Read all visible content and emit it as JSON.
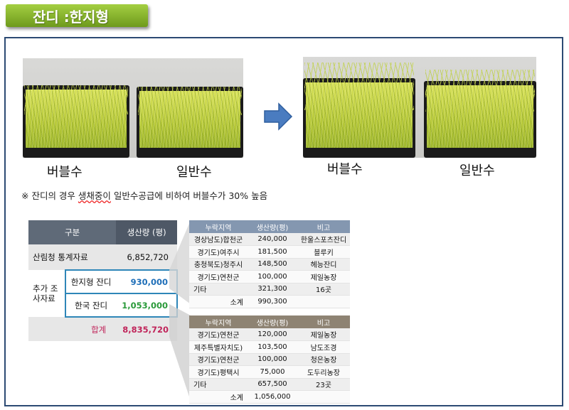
{
  "title": "잔디 :한지형",
  "photos": {
    "left_caption_1": "버블수",
    "left_caption_2": "일반수",
    "right_caption_1": "버블수",
    "right_caption_2": "일반수"
  },
  "note": {
    "prefix": "※ 잔디의 경우 ",
    "misspelled": "생채중이",
    "suffix": " 일반수공급에 비하여 버블수가 30% 높음"
  },
  "main_table": {
    "header_category": "구분",
    "header_production": "생산량 (평)",
    "row_forest_label": "산림청 통계자료",
    "row_forest_value": "6,852,720",
    "group_label": "추가 조사자료",
    "row_cool_label": "한지형 잔디",
    "row_cool_value": "930,000",
    "row_korean_label": "한국 잔디",
    "row_korean_value": "1,053,000",
    "total_label": "합계",
    "total_value": "8,835,720"
  },
  "top_table": {
    "headers": [
      "누락지역",
      "생산량(평)",
      "비고"
    ],
    "rows": [
      [
        "경상남도)합천군",
        "240,000",
        "한울스포츠잔디"
      ],
      [
        "경기도)여주시",
        "181,500",
        "블루키"
      ],
      [
        "충청북도)청주시",
        "148,500",
        "헤능잔디"
      ],
      [
        "경기도)연천군",
        "100,000",
        "제일농장"
      ],
      [
        "기타",
        "321,300",
        "16곳"
      ]
    ],
    "subtotal_label": "소계",
    "subtotal_value": "990,300"
  },
  "bottom_table": {
    "headers": [
      "누락지역",
      "생산량(평)",
      "비고"
    ],
    "rows": [
      [
        "경기도)연천군",
        "120,000",
        "제일농장"
      ],
      [
        "제주특별자치도)",
        "103,500",
        "남도조경"
      ],
      [
        "경기도)연천군",
        "100,000",
        "청은농장"
      ],
      [
        "경기도)평택시",
        "75,000",
        "도두리농장"
      ],
      [
        "기타",
        "657,500",
        "23곳"
      ]
    ],
    "subtotal_label": "소계",
    "subtotal_value": "1,056,000"
  },
  "colors": {
    "title_bg": "#8bb832",
    "frame_border": "#2c4a73",
    "arrow": "#4a7cc0",
    "cool_value": "#1f6fb8",
    "korean_value": "#2a9a3a",
    "total_value": "#c0245a",
    "highlight_border": "#2e86b8",
    "top_header": "#8497b0",
    "bottom_header": "#8e8373"
  }
}
